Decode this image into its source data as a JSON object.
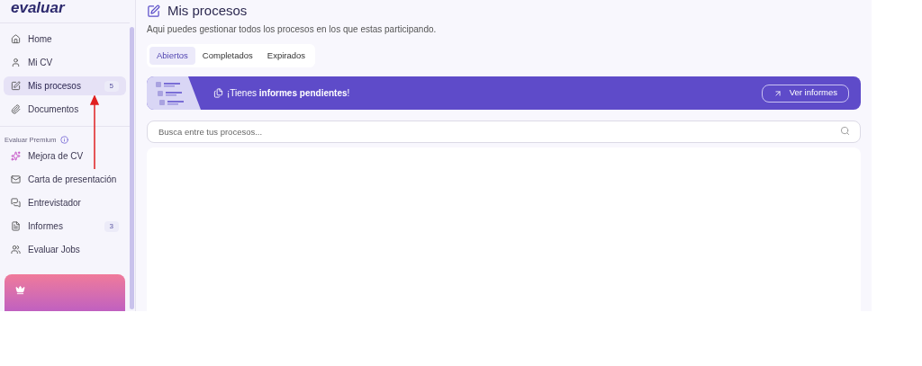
{
  "logo": "evaluar",
  "sidebar": {
    "items": [
      {
        "label": "Home",
        "selected": false
      },
      {
        "label": "Mi CV",
        "selected": false
      },
      {
        "label": "Mis procesos",
        "selected": true,
        "count": "5"
      },
      {
        "label": "Documentos",
        "selected": false
      }
    ],
    "section_title": "Evaluar Premium",
    "premium_items": [
      {
        "label": "Mejora de CV",
        "selected": false
      },
      {
        "label": "Carta de presentación",
        "selected": false
      },
      {
        "label": "Entrevistador",
        "selected": false
      },
      {
        "label": "Informes",
        "selected": false,
        "count": "3"
      },
      {
        "label": "Evaluar Jobs",
        "selected": false
      }
    ]
  },
  "page": {
    "title": "Mis procesos",
    "subtitle": "Aqui puedes gestionar todos los procesos en los que estas participando.",
    "tabs": [
      {
        "label": "Abiertos",
        "selected": true
      },
      {
        "label": "Completados",
        "selected": false
      },
      {
        "label": "Expirados",
        "selected": false
      }
    ],
    "banner": {
      "text": "¡Tienes **informes pendientes**!",
      "button": "Ver informes"
    },
    "search": {
      "placeholder": "Busca entre tus procesos..."
    }
  }
}
